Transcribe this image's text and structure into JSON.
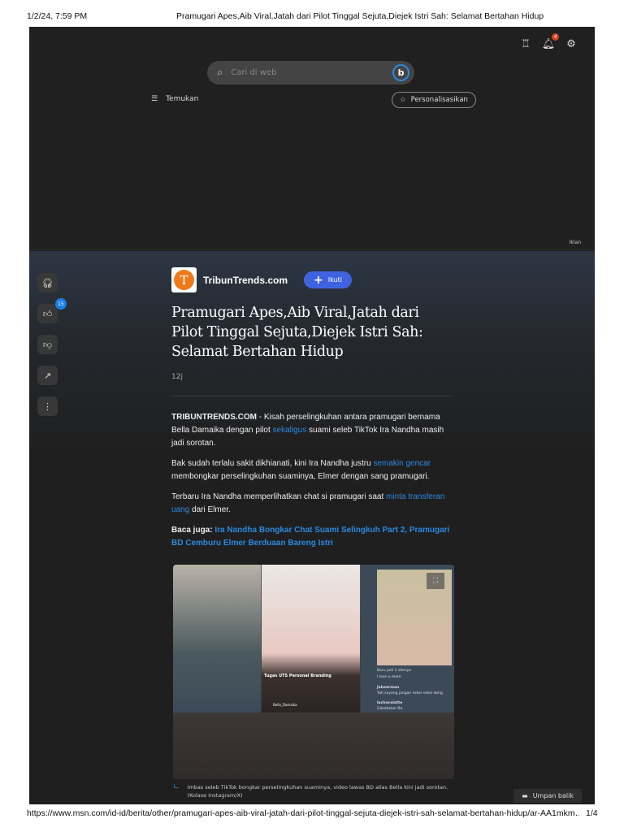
{
  "print": {
    "datetime": "1/2/24, 7:59 PM",
    "title": "Pramugari Apes,Aib Viral,Jatah dari Pilot Tinggal Sejuta,Diejek Istri Sah: Selamat Bertahan Hidup",
    "url": "https://www.msn.com/id-id/berita/other/pramugari-apes-aib-viral-jatah-dari-pilot-tinggal-sejuta-diejek-istri-sah-selamat-bertahan-hidup/ar-AA1mkm…",
    "page": "1/4"
  },
  "header": {
    "notification_count": "4",
    "search_placeholder": "Cari di web",
    "nav_label": "Temukan",
    "personalize_label": "Personalisasikan",
    "ad_label": "Iklan"
  },
  "rail": {
    "like_count": "15"
  },
  "article": {
    "source": "TribunTrends.com",
    "follow_label": "Ikuti",
    "title": "Pramugari Apes,Aib Viral,Jatah dari Pilot Tinggal Sejuta,Diejek Istri Sah: Selamat Bertahan Hidup",
    "time": "12j",
    "p1_lead": "TRIBUNTRENDS.COM",
    "p1_a": " - Kisah perselingkuhan antara pramugari bernama Bella Damaika dengan pilot ",
    "p1_link": "sekaligus",
    "p1_b": " suami seleb TikTok Ira Nandha masih jadi sorotan.",
    "p2_a": "Bak sudah terlalu sakit dikhianati, kini Ira Nandha justru ",
    "p2_link": "semakin gencar",
    "p2_b": " membongkar perselingkuhan suaminya, Elmer dengan sang pramugari.",
    "p3_a": "Terbaru Ira Nandha memperlihatkan chat si pramugari saat ",
    "p3_link": "minta transferan uang",
    "p3_b": " dari Elmer.",
    "read_also_label": "Baca juga:",
    "read_also_link": "Ira Nandha Bongkar Chat Suami Selingkuh Part 2, Pramugari BD Cemburu Elmer Berduaan Bareng Istri",
    "image_text": {
      "video_title": "Tugas UTS Personal Branding",
      "channel": "Bella_Damaika",
      "chat1": "Baru jadi 1 alienya",
      "chat2": "I love u more",
      "user1": "Jaheerman",
      "msg1": "Yah sayang jangan sekoi sekoi dong",
      "user2": "lachocolatte",
      "msg2": "Gakebelan Ra"
    },
    "caption": "Imbas seleb TikTok bongkar perselingkuhan suaminya, video lawas BD alias Bella kini jadi sorotan. (Kolase Instagram/X)"
  },
  "feedback_label": "Umpan balik"
}
